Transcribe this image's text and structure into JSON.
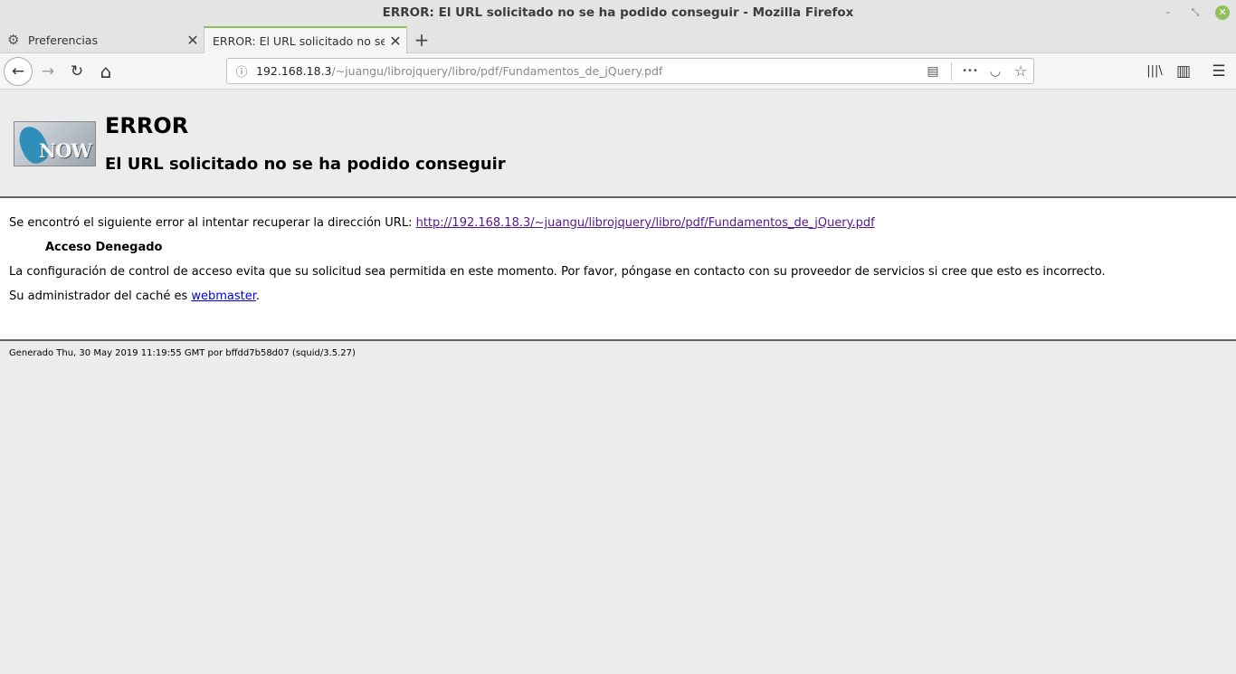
{
  "window": {
    "title": "ERROR: El URL solicitado no se ha podido conseguir - Mozilla Firefox",
    "min_glyph": "–",
    "restore_glyph": "⤡",
    "close_glyph": "✕"
  },
  "tabs": [
    {
      "label": "Preferencias",
      "icon": "gear-icon",
      "active": false
    },
    {
      "label": "ERROR: El URL solicitado no se ha",
      "active": true
    }
  ],
  "glyphs": {
    "gear": "⚙",
    "close": "✕",
    "plus": "+",
    "back": "←",
    "forward": "→",
    "reload": "↻",
    "home": "⌂",
    "info": "ⓘ",
    "reader": "▤",
    "more": "•••",
    "pocket": "◡",
    "star": "☆",
    "library": "|||\\",
    "sidebar": "▥",
    "menu": "☰"
  },
  "urlbar": {
    "host": "192.168.18.3",
    "path": "/~juangu/librojquery/libro/pdf/Fundamentos_de_jQuery.pdf"
  },
  "page": {
    "logo_text": "NOW",
    "heading": "ERROR",
    "subheading": "El URL solicitado no se ha podido conseguir",
    "error_intro": "Se encontró el siguiente error al intentar recuperar la dirección URL: ",
    "error_url": "http://192.168.18.3/~juangu/librojquery/libro/pdf/Fundamentos_de_jQuery.pdf",
    "denied": "Acceso Denegado",
    "explanation": "La configuración de control de acceso evita que su solicitud sea permitida en este momento. Por favor, póngase en contacto con su proveedor de servicios si cree que esto es incorrecto.",
    "admin_intro": "Su administrador del caché es ",
    "admin_link": "webmaster",
    "admin_end": ".",
    "footer": "Generado Thu, 30 May 2019 11:19:55 GMT por bffdd7b58d07 (squid/3.5.27)"
  }
}
